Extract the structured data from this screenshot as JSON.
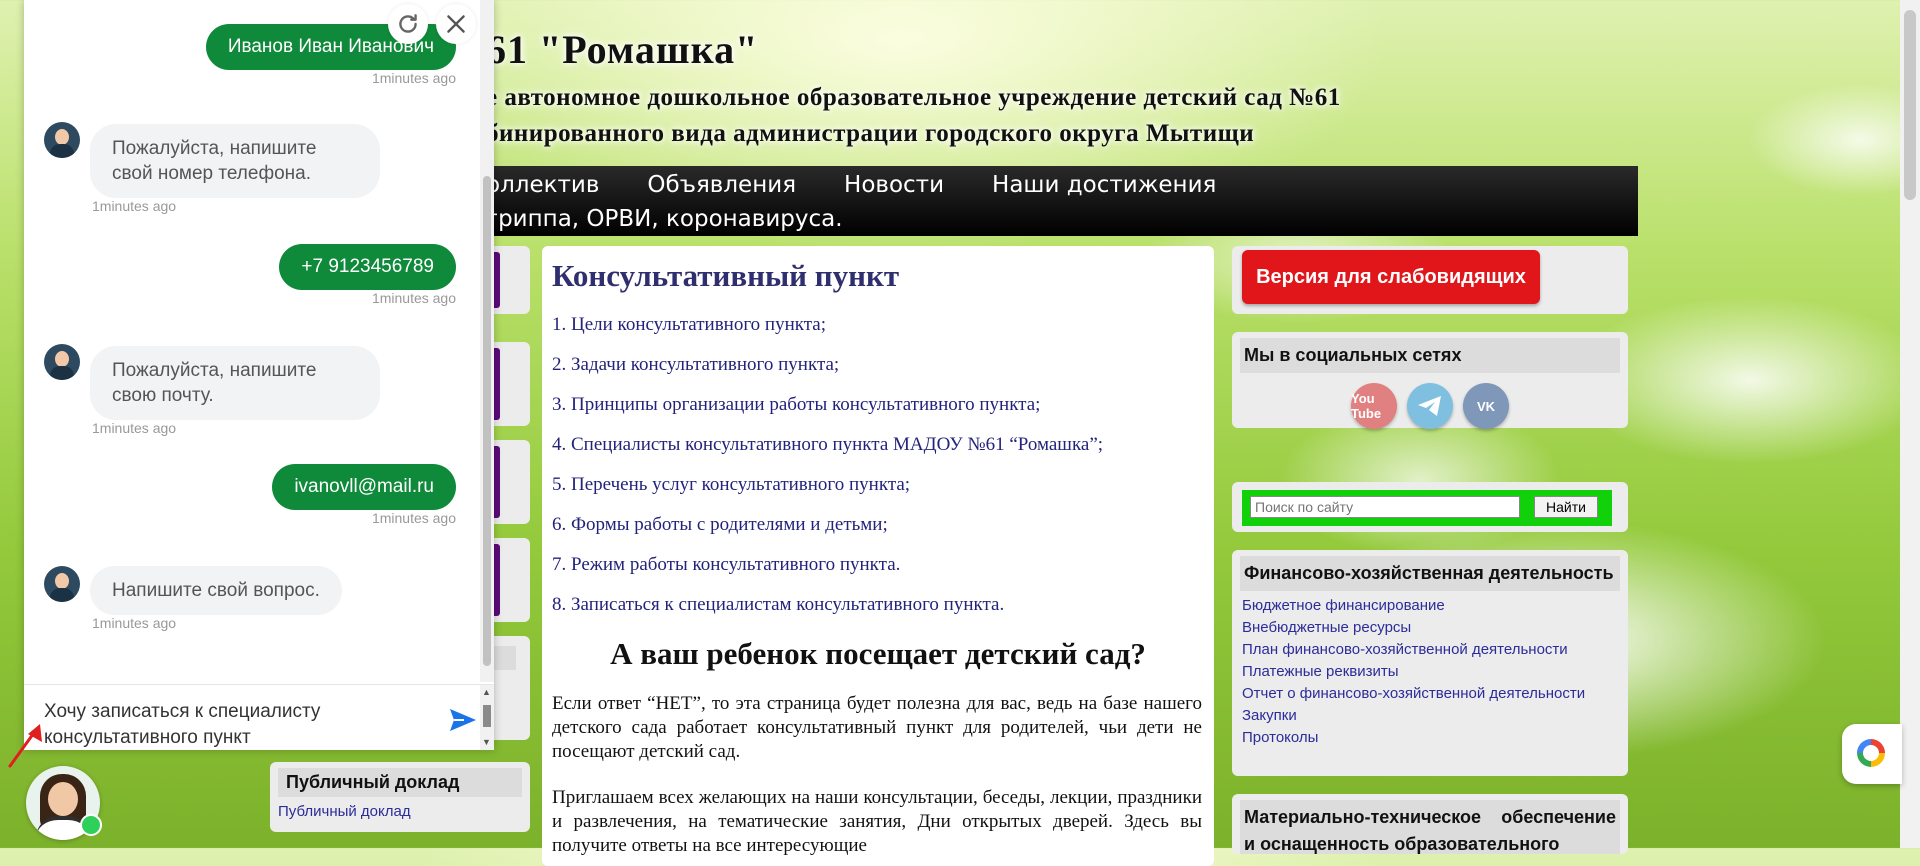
{
  "header": {
    "title": "61 \"Ромашка\"",
    "subtitle_line1": "е автономное дошкольное образовательное учреждение детский сад №61",
    "subtitle_line2": "бинированного вида администрации городского округа Мытищи"
  },
  "nav": {
    "items": [
      "оллектив",
      "Объявления",
      "Новости",
      "Наши достижения"
    ],
    "row2": "гриппа, ОРВИ, коронавируса."
  },
  "main": {
    "title": "Консультативный пункт",
    "toc": [
      "1. Цели консультативного пункта;",
      "2. Задачи консультативного пункта;",
      "3. Принципы организации работы консультативного пункта;",
      "4. Специалисты консультативного пункта МАДОУ №61 “Ромашка”;",
      "5. Перечень услуг консультативного пункта;",
      "6. Формы работы с родителями и детьми;",
      "7. Режим работы консультативного пункта.",
      "8. Записаться к специалистам консультативного пункта."
    ],
    "subtitle": "А ваш ребенок посещает детский сад?",
    "para1": "Если ответ “НЕТ”, то эта страница будет полезна для вас, ведь на базе нашего детского сада работает консультативный пункт для родителей, чьи дети не посещают детский сад.",
    "para2": "Приглашаем всех желающих на наши консультации, беседы, лекции, праздники и развлечения, на тематические занятия, Дни открытых дверей. Здесь вы получите ответы на все интересующие"
  },
  "left": {
    "report_header": "Публичный доклад",
    "report_link": "Публичный доклад"
  },
  "right": {
    "vision_button": "Версия для слабовидящих",
    "social_header": "Мы в социальных сетях",
    "social": [
      {
        "name": "youtube",
        "label": "You Tube"
      },
      {
        "name": "telegram",
        "label": ""
      },
      {
        "name": "vk",
        "label": "VK"
      }
    ],
    "search_placeholder": "Поиск по сайту",
    "search_button": "Найти",
    "finance_header": "Финансово-хозяйственная деятельность",
    "finance_links": [
      "Бюджетное финансирование",
      "Внебюджетные ресурсы",
      "План финансово-хозяйственной деятельности",
      "Платежные реквизиты",
      "Отчет о финансово-хозяйственной деятельности",
      "Закупки",
      "Протоколы"
    ],
    "mt_header": "Материально-техническое обеспечение и оснащенность образовательного"
  },
  "chat": {
    "messages": [
      {
        "dir": "out",
        "text": "Иванов Иван Иванович",
        "time": "1minutes ago"
      },
      {
        "dir": "in",
        "text": "Пожалуйста, напишите свой номер телефона.",
        "time": "1minutes ago"
      },
      {
        "dir": "out",
        "text": "+7 9123456789",
        "time": "1minutes ago"
      },
      {
        "dir": "in",
        "text": "Пожалуйста, напишите свою почту.",
        "time": "1minutes ago"
      },
      {
        "dir": "out",
        "text": "ivanovll@mail.ru",
        "time": "1minutes ago"
      },
      {
        "dir": "in",
        "text": "Напишите свой вопрос.",
        "time": "1minutes ago"
      }
    ],
    "composer_value": "Хочу записаться к специалисту консультативного пункт"
  },
  "colors": {
    "chat_green": "#0e8a3a",
    "vision_red": "#e0161a",
    "search_green": "#10d10a",
    "nav_black": "#000000",
    "link_blue": "#2c2c9a"
  }
}
